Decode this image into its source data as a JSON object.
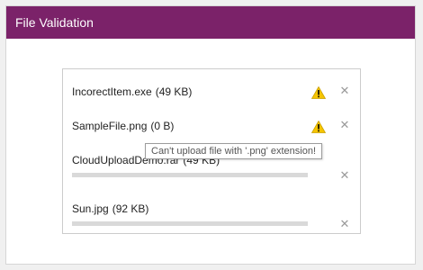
{
  "header": {
    "title": "File Validation"
  },
  "files": [
    {
      "name": "IncorectItem.exe",
      "size": "(49 KB)",
      "warning": true,
      "progress": null
    },
    {
      "name": "SampleFile.png",
      "size": "(0 B)",
      "warning": true,
      "progress": null
    },
    {
      "name": "CloudUploadDemo.rar",
      "size": "(49 KB)",
      "warning": false,
      "progress": 1.0
    },
    {
      "name": "Sun.jpg",
      "size": "(92 KB)",
      "warning": false,
      "progress": 1.0
    }
  ],
  "remove_glyph": "✕",
  "tooltip": {
    "text": "Can't upload file with '.png' extension!"
  },
  "colors": {
    "header_bg": "#7b2269",
    "warning": "#f5c400",
    "progress": "#d9d9d9"
  }
}
